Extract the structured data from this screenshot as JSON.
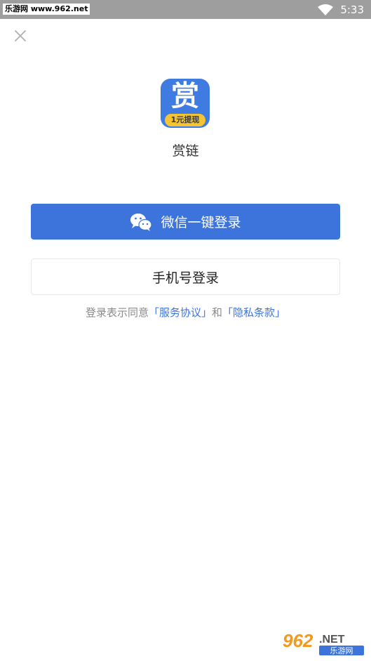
{
  "status_bar": {
    "watermark": "乐游网 www.962.net",
    "time": "5:33"
  },
  "app": {
    "icon_glyph": "赏",
    "icon_ribbon": "1元提现",
    "name": "赏链"
  },
  "buttons": {
    "wechat_login": "微信一键登录",
    "phone_login": "手机号登录"
  },
  "agreement": {
    "prefix": "登录表示同意",
    "service": "「服务协议」",
    "and": "和",
    "privacy": "「隐私条款」"
  },
  "watermark_bottom": {
    "number": "962",
    "suffix": ".NET",
    "label": "乐游网"
  },
  "colors": {
    "primary": "#3d74dc",
    "ribbon": "#f4c432",
    "status_bar": "#9e9e9e"
  }
}
